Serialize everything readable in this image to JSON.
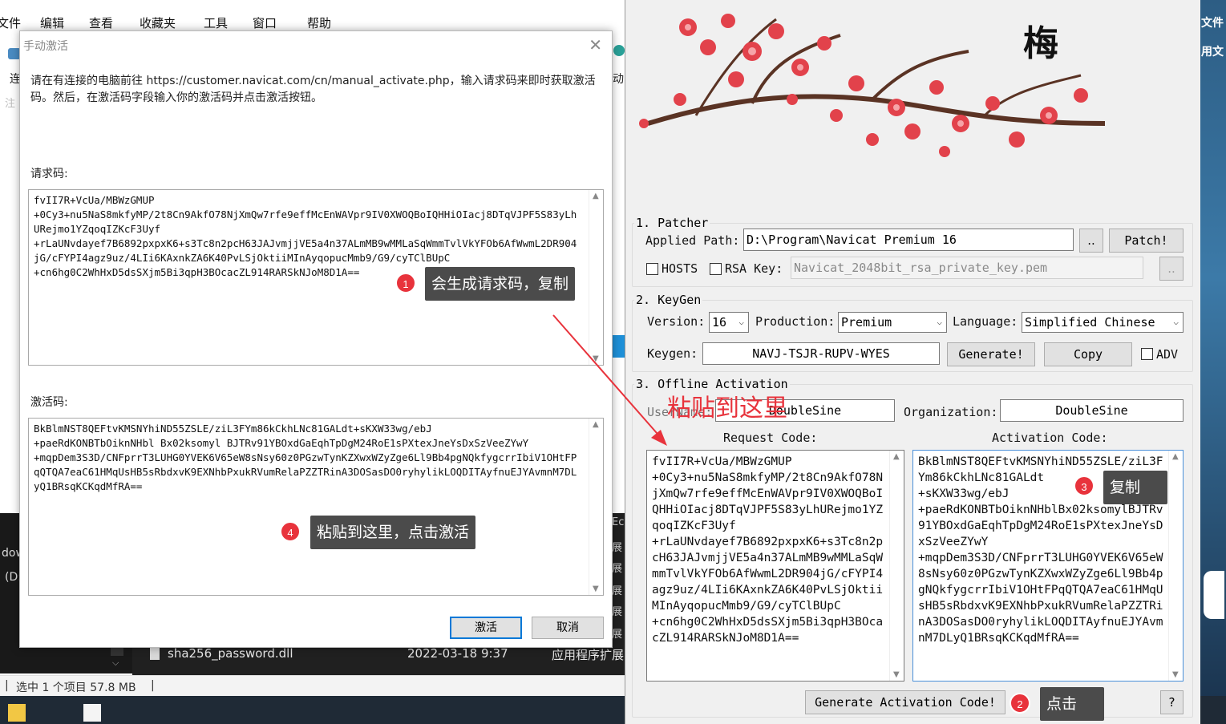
{
  "explorer": {
    "menu": [
      "文件",
      "编辑",
      "查看",
      "收藏夹",
      "工具",
      "窗口",
      "帮助"
    ],
    "toolbar_frag_1": "连",
    "toolbar_frag_2": "动",
    "toolbar_frag_3": "注",
    "side_frag_1": "dow",
    "side_frag_2": "(D:",
    "files": [
      {
        "name": "sha256_password.dll",
        "date": "2022-03-18 9:37",
        "type": "应用程序扩展"
      }
    ],
    "status": "选中 1 个项目  57.8 MB",
    "status_sep_left": "|",
    "status_sep_right": "|",
    "type_col_frags": [
      "Ec",
      "展",
      "展",
      "展",
      "展",
      "展"
    ]
  },
  "desktop": {
    "label_1": "文件",
    "label_2": "用文"
  },
  "dialog": {
    "title": "手动激活",
    "close": "✕",
    "instruction": "请在有连接的电脑前往 https://customer.navicat.com/cn/manual_activate.php，输入请求码来即时获取激活码。然后，在激活码字段输入你的激活码并点击激活按钮。",
    "request_label": "请求码:",
    "request_code": "fvII7R+VcUa/MBWzGMUP\n+0Cy3+nu5NaS8mkfyMP/2t8Cn9AkfO78NjXmQw7rfe9effMcEnWAVpr9IV0XWOQBoIQHHiOIacj8DTqVJPF5S83yLhURejmo1YZqoqIZKcF3Uyf\n+rLaUNvdayef7B6892pxpxK6+s3Tc8n2pcH63JAJvmjjVE5a4n37ALmMB9wMMLaSqWmmTvlVkYFOb6AfWwmL2DR904jG/cFYPI4agz9uz/4LIi6KAxnkZA6K40PvLSjOktiiMInAyqopucMmb9/G9/cyTClBUpC\n+cn6hg0C2WhHxD5dsSXjm5Bi3qpH3BOcacZL914RARSkNJoM8D1A==",
    "activation_label": "激活码:",
    "activation_code": "BkBlmNST8QEFtvKMSNYhiND55ZSLE/ziL3FYm86kCkhLNc81GALdt+sKXW33wg/ebJ\n+paeRdKONBTbOiknNHbl Bx02ksomyl BJTRv91YBOxdGaEqhTpDgM24RoE1sPXtexJneYsDxSzVeeZYwY\n+mqpDem3S3D/CNFprrT3LUHG0YVEK6V65eW8sNsy60z0PGzwTynKZXwxWZyZge6Ll9Bb4pgNQkfygcrrIbiV1OHtFPqQTQA7eaC61HMqUsHB5sRbdxvK9EXNhbPxukRVumRelaPZZTRinA3DOSasDO0ryhylikLOQDITAyfnuEJYAvmnM7DLyQ1BRsqKCKqdMfRA==",
    "activate_btn": "激活",
    "cancel_btn": "取消"
  },
  "keygen": {
    "logo_char": "梅",
    "patcher": {
      "legend": "1. Patcher",
      "applied_path_label": "Applied Path:",
      "applied_path": "D:\\Program\\Navicat Premium 16",
      "browse_btn": "..",
      "patch_btn": "Patch!",
      "hosts_label": "HOSTS",
      "rsa_label": "RSA Key:",
      "rsa_value": "Navicat_2048bit_rsa_private_key.pem",
      "rsa_browse": ".."
    },
    "keygen": {
      "legend": "2. KeyGen",
      "version_label": "Version:",
      "version": "16",
      "production_label": "Production:",
      "production": "Premium",
      "language_label": "Language:",
      "language": "Simplified Chinese",
      "keygen_label": "Keygen:",
      "key": "NAVJ-TSJR-RUPV-WYES",
      "generate_btn": "Generate!",
      "copy_btn": "Copy",
      "adv_label": "ADV"
    },
    "offline": {
      "legend": "3. Offline Activation",
      "username_label": "UserName:",
      "username": "DoubleSine",
      "organization_label": "Organization:",
      "organization": "DoubleSine",
      "request_label": "Request Code:",
      "activation_label": "Activation Code:",
      "request_code": "fvII7R+VcUa/MBWzGMUP\n+0Cy3+nu5NaS8mkfyMP/2t8Cn9AkfO78NjXmQw7rfe9effMcEnWAVpr9IV0XWOQBoIQHHiOIacj8DTqVJPF5S83yLhURejmo1YZqoqIZKcF3Uyf\n+rLaUNvdayef7B6892pxpxK6+s3Tc8n2pcH63JAJvmjjVE5a4n37ALmMB9wMMLaSqWmmTvlVkYFOb6AfWwmL2DR904jG/cFYPI4agz9uz/4LIi6KAxnkZA6K40PvLSjOktiiMInAyqopucMmb9/G9/cyTClBUpC\n+cn6hg0C2WhHxD5dsSXjm5Bi3qpH3BOcacZL914RARSkNJoM8D1A==",
      "activation_code": "BkBlmNST8QEFtvKMSNYhiND55ZSLE/ziL3FYm86kCkhLNc81GALdt\n+sKXW33wg/ebJ\n+paeRdKONBTbOiknNHblBx02ksomylBJTRv91YBOxdGaEqhTpDgM24RoE1sPXtexJneYsDxSzVeeZYwY\n+mqpDem3S3D/CNFprrT3LUHG0YVEK6V65eW8sNsy60z0PGzwTynKZXwxWZyZge6Ll9Bb4pgNQkfygcrrIbiV1OHtFPqQTQA7eaC61HMqUsHB5sRbdxvK9EXNhbPxukRVumRelaPZZTRinA3DOSasDO0ryhylikLOQDITAyfnuEJYAvmnM7DLyQ1BRsqKCKqdMfRA==",
      "generate_btn": "Generate Activation Code!",
      "help_btn": "?"
    }
  },
  "annotations": {
    "step1_num": "1",
    "step1": "会生成请求码，复制",
    "step2_num": "2",
    "step2": "点击",
    "step3_num": "3",
    "step3": "复制",
    "step4_num": "4",
    "step4": "粘贴到这里，点击激活",
    "paste_here": "粘贴到这里"
  },
  "colors": {
    "accent": "#0078d7",
    "annotation_red": "#e8333c",
    "callout_bg": "#4b4b4b"
  }
}
